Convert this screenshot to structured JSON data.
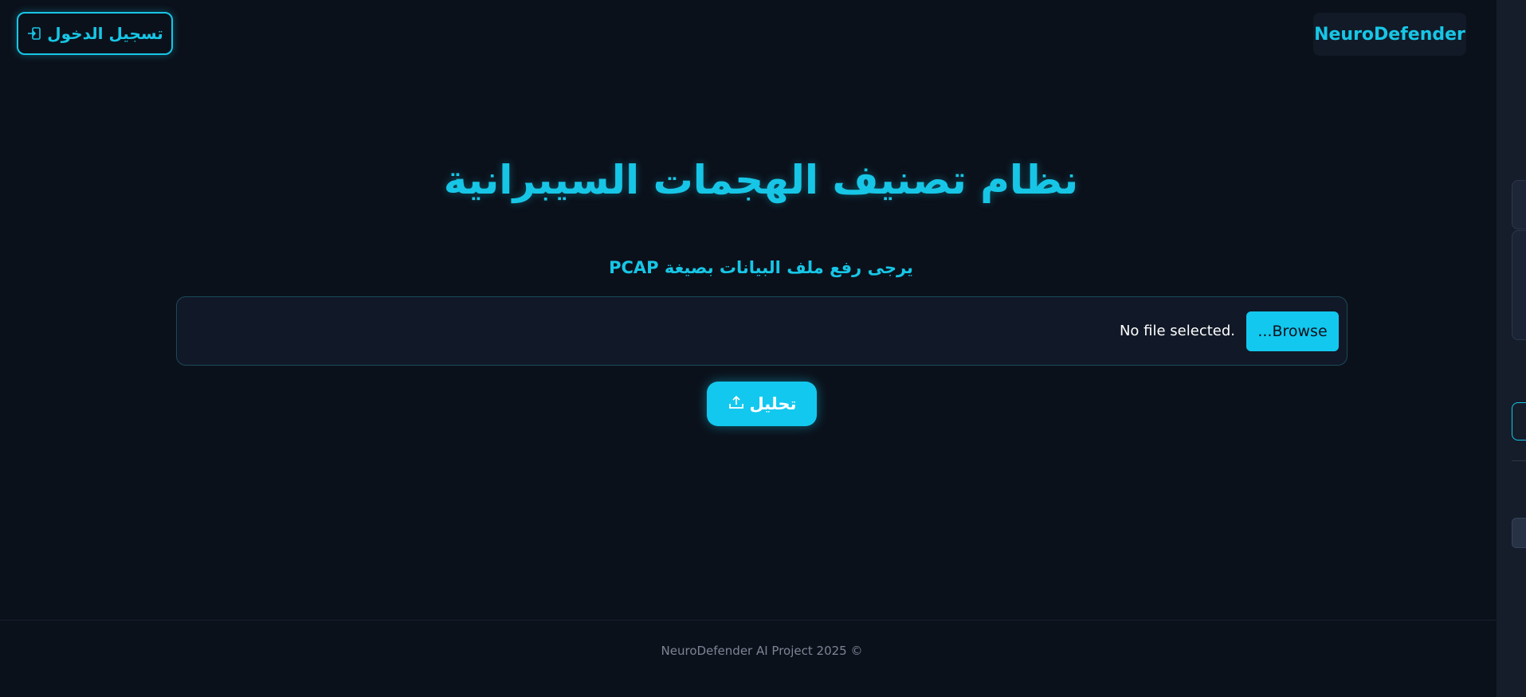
{
  "header": {
    "login_label": "تسجيل الدخول",
    "login_icon": "sign-in-icon",
    "brand": "NeuroDefender"
  },
  "main": {
    "title": "نظام تصنيف الهجمات السيبرانية",
    "upload_prompt": "يرجى رفع ملف البيانات بصيغة PCAP",
    "browse_label": "...Browse",
    "file_status": "No file selected.",
    "analyze_label": "تحليل",
    "analyze_icon": "upload-icon"
  },
  "footer": {
    "copyright": "NeuroDefender AI Project 2025 ©"
  },
  "colors": {
    "accent": "#17c6e6",
    "background": "#0b111b",
    "panel": "#111827"
  }
}
